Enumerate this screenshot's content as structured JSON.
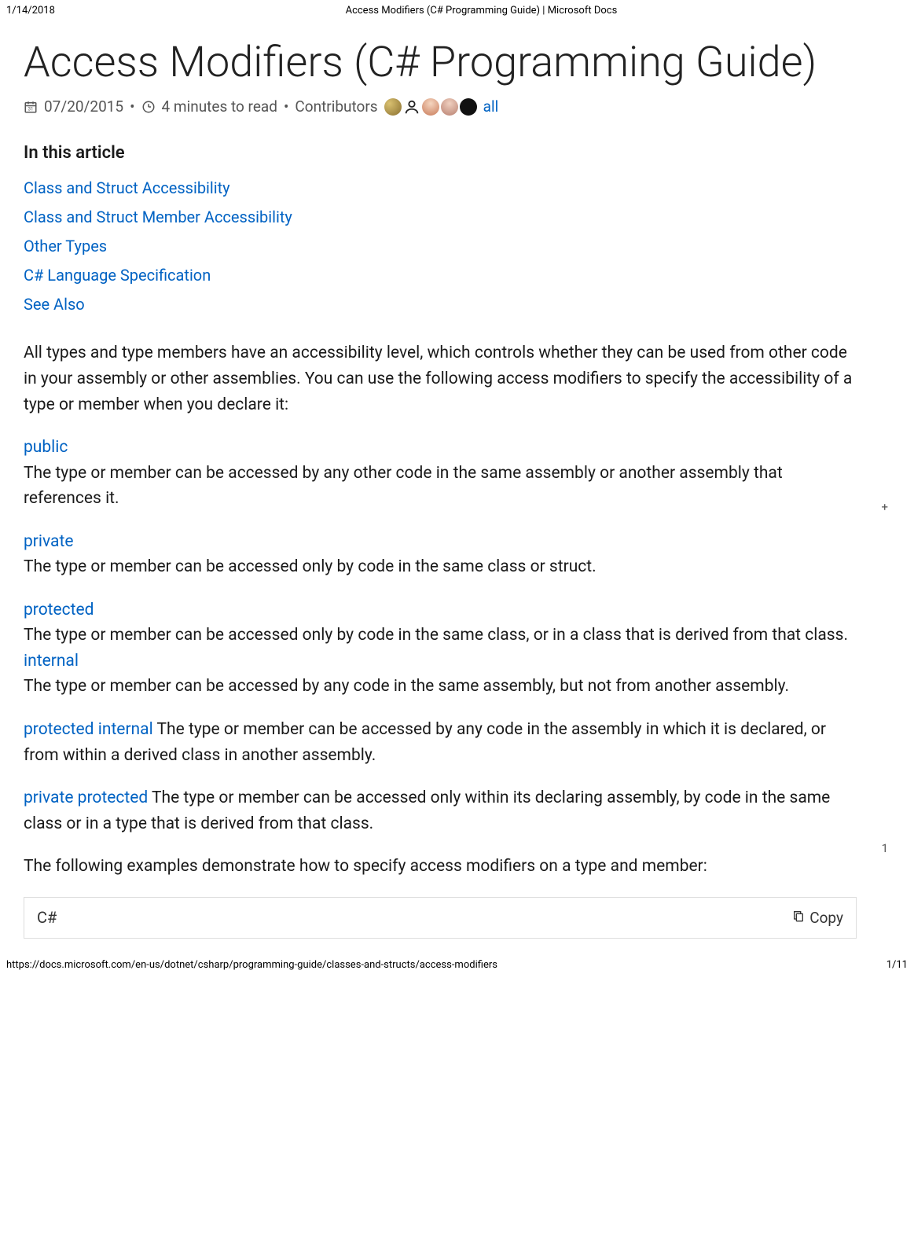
{
  "print": {
    "date": "1/14/2018",
    "title": "Access Modifiers (C# Programming Guide) | Microsoft Docs",
    "url": "https://docs.microsoft.com/en-us/dotnet/csharp/programming-guide/classes-and-structs/access-modifiers",
    "page": "1/11"
  },
  "header": {
    "title": "Access Modifiers (C# Programming Guide)",
    "date": "07/20/2015",
    "read_time": "4 minutes to read",
    "contributors_label": "Contributors",
    "all_link": "all"
  },
  "toc": {
    "heading": "In this article",
    "items": [
      "Class and Struct Accessibility",
      "Class and Struct Member Accessibility",
      "Other Types",
      "C# Language Specification",
      "See Also"
    ]
  },
  "intro": "All types and type members have an accessibility level, which controls whether they can be used from other code in your assembly or other assemblies. You can use the following access modifiers to specify the accessibility of a type or member when you declare it:",
  "modifiers": {
    "public": {
      "label": "public",
      "desc": "The type or member can be accessed by any other code in the same assembly or another assembly that references it."
    },
    "private": {
      "label": "private",
      "desc": "The type or member can be accessed only by code in the same class or struct."
    },
    "protected": {
      "label": "protected",
      "desc": "The type or member can be accessed only by code in the same class, or in a class that is derived from that class."
    },
    "internal": {
      "label": "internal",
      "desc": "The type or member can be accessed by any code in the same assembly, but not from another assembly."
    },
    "protected_internal": {
      "label": "protected internal",
      "desc": " The type or member can be accessed by any code in the assembly in which it is declared, or from within a derived class in another assembly."
    },
    "private_protected": {
      "label": "private protected",
      "desc": " The type or member can be accessed only within its declaring assembly, by code in the same class or in a type that is derived from that class."
    }
  },
  "examples_intro": "The following examples demonstrate how to specify access modifiers on a type and member:",
  "code": {
    "language": "C#",
    "copy_label": "Copy"
  },
  "margin": {
    "plus": "+",
    "one": "1"
  }
}
